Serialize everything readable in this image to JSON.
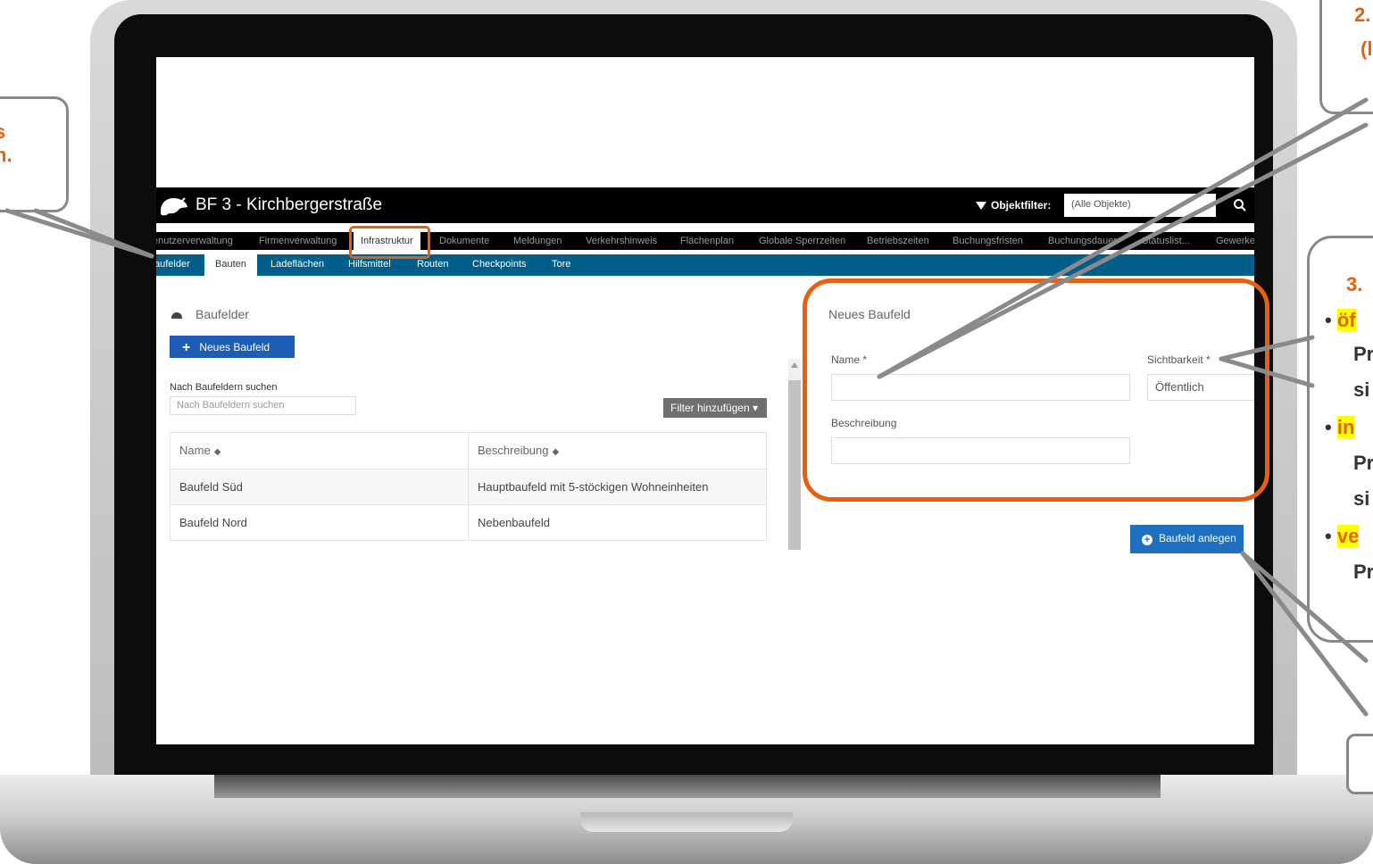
{
  "app": {
    "title": "BF 3 - Kirchbergerstraße",
    "objektfilter_label": "Objektfilter:",
    "objektfilter_value": "(Alle Objekte)"
  },
  "main_nav": [
    {
      "label": "enutzerverwaltung"
    },
    {
      "label": "Firmenverwaltung"
    },
    {
      "label": "Infrastruktur"
    },
    {
      "label": "Dokumente"
    },
    {
      "label": "Meldungen"
    },
    {
      "label": "Verkehrshinweis"
    },
    {
      "label": "Flächenplan"
    },
    {
      "label": "Globale Sperrzeiten"
    },
    {
      "label": "Betriebszeiten"
    },
    {
      "label": "Buchungsfristen"
    },
    {
      "label": "Buchungsdauer"
    },
    {
      "label": "Statuslist..."
    },
    {
      "label": "Gewerke"
    }
  ],
  "sub_nav": [
    {
      "label": "aufelder"
    },
    {
      "label": "Bauten"
    },
    {
      "label": "Ladeflächen"
    },
    {
      "label": "Hilfsmittel"
    },
    {
      "label": "Routen"
    },
    {
      "label": "Checkpoints"
    },
    {
      "label": "Tore"
    }
  ],
  "list_panel": {
    "title": "Baufelder",
    "new_button": "Neues Baufeld",
    "search_label": "Nach Baufeldern suchen",
    "search_placeholder": "Nach Baufeldern suchen",
    "filter_button": "Filter hinzufügen ▾",
    "columns": [
      "Name",
      "Beschreibung"
    ],
    "rows": [
      {
        "name": "Baufeld Süd",
        "beschreibung": "Hauptbaufeld mit 5-stöckigen Wohneinheiten"
      },
      {
        "name": "Baufeld Nord",
        "beschreibung": "Nebenbaufeld"
      }
    ]
  },
  "form": {
    "title": "Neues Baufeld",
    "name_label": "Name *",
    "name_value": "",
    "visibility_label": "Sichtbarkeit *",
    "visibility_value": "Öffentlich",
    "description_label": "Beschreibung",
    "description_value": "",
    "submit_button": "Baufeld anlegen"
  },
  "callouts": {
    "left": [
      "s",
      "n."
    ],
    "top_right": [
      "2.",
      "(l"
    ],
    "right": {
      "number": "3.",
      "items": [
        {
          "highlight": "öf",
          "lines": [
            "Pr",
            "si"
          ]
        },
        {
          "highlight": "in",
          "lines": [
            "Pr",
            "si"
          ]
        },
        {
          "highlight": "ve",
          "lines": [
            "Pr"
          ]
        }
      ]
    }
  },
  "colors": {
    "accent_orange": "#e8600f",
    "header_black": "#000000",
    "subnav_blue": "#005e8a",
    "button_blue": "#1e5db5",
    "highlight_yellow": "#ffff00"
  }
}
